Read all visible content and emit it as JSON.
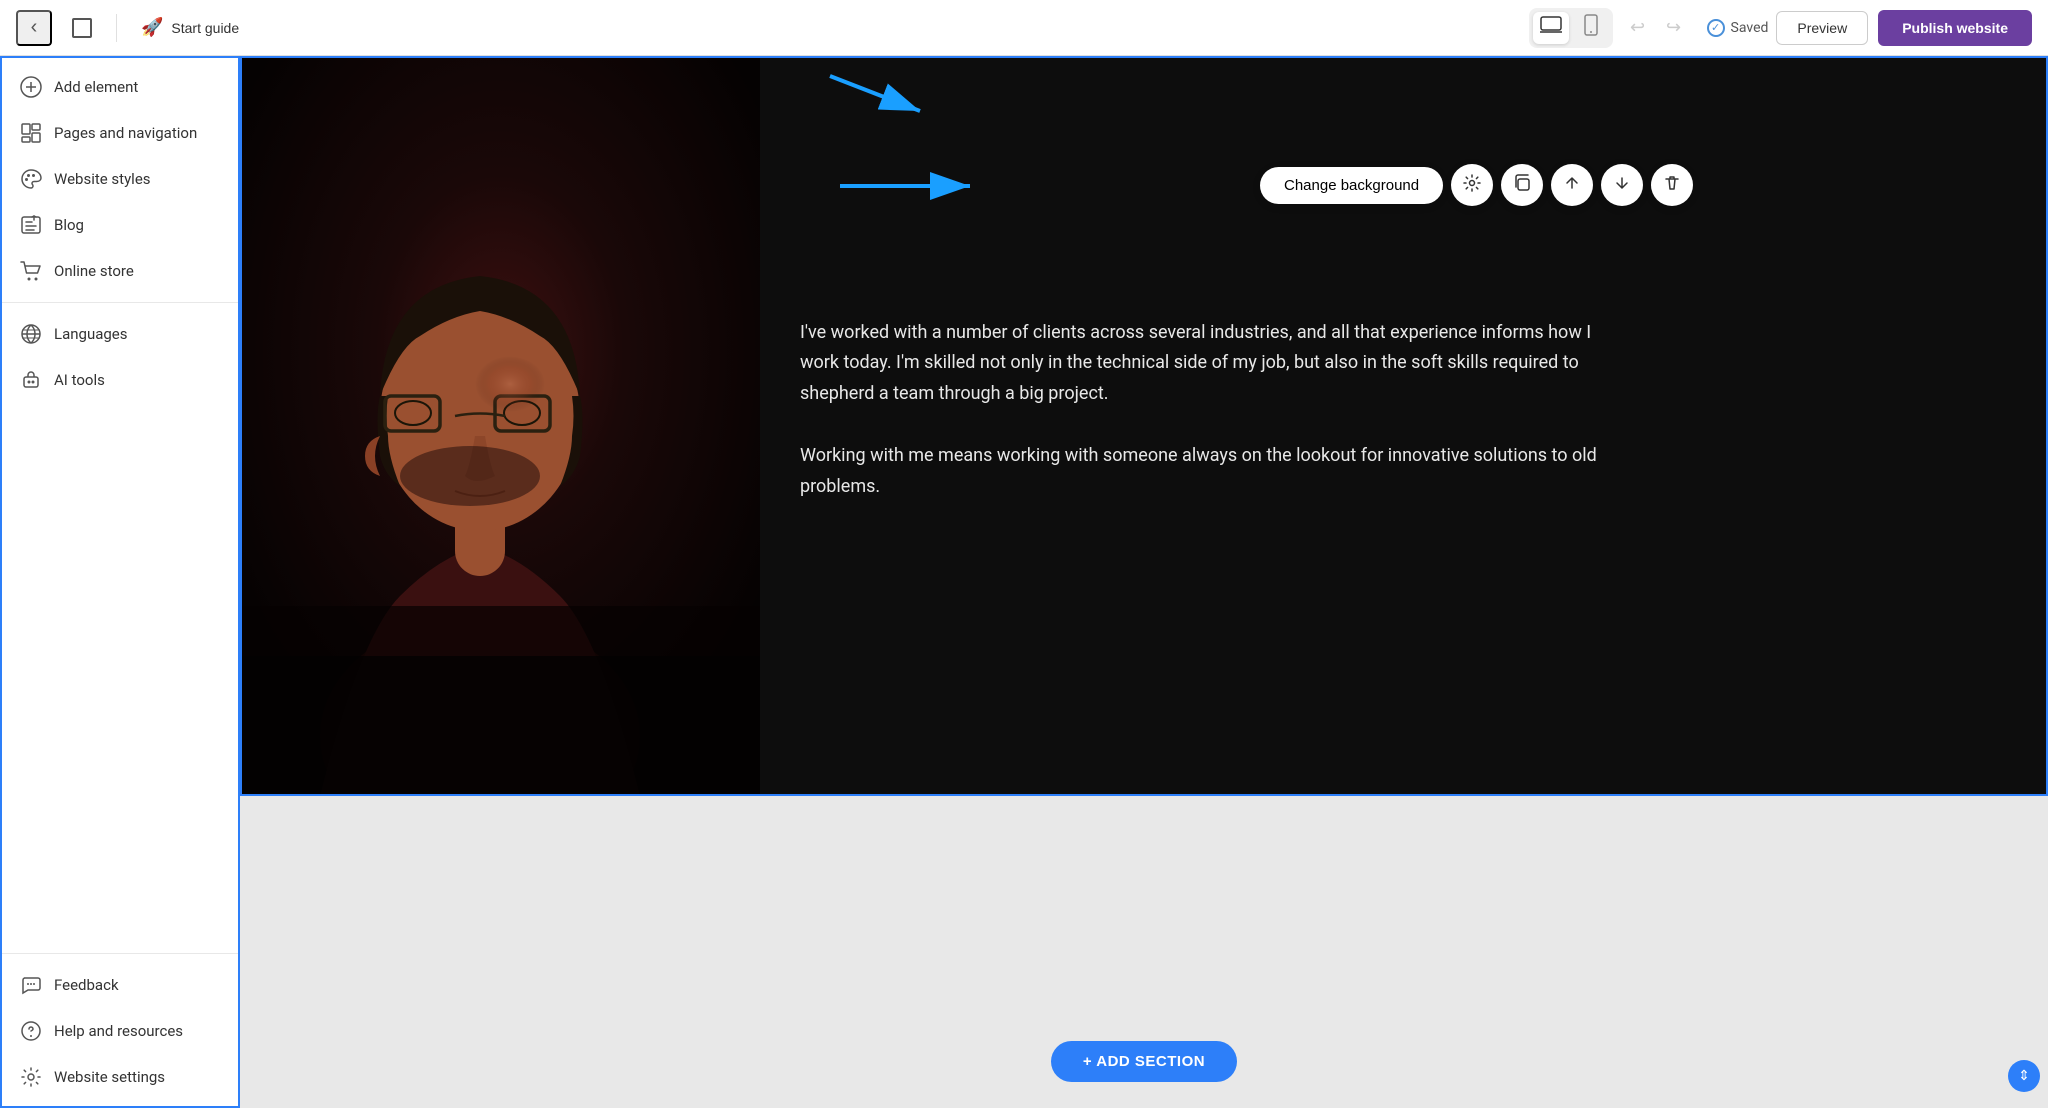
{
  "toolbar": {
    "back_icon": "‹",
    "layout_icon": "⊡",
    "start_guide_label": "Start guide",
    "device_laptop_icon": "💻",
    "device_mobile_icon": "📱",
    "undo_icon": "↩",
    "redo_icon": "↪",
    "saved_label": "Saved",
    "preview_label": "Preview",
    "publish_label": "Publish website"
  },
  "sidebar": {
    "items": [
      {
        "id": "add-element",
        "icon": "⊕",
        "label": "Add element"
      },
      {
        "id": "pages-navigation",
        "icon": "◫",
        "label": "Pages and navigation"
      },
      {
        "id": "website-styles",
        "icon": "🎨",
        "label": "Website styles"
      },
      {
        "id": "blog",
        "icon": "✏️",
        "label": "Blog"
      },
      {
        "id": "online-store",
        "icon": "🛒",
        "label": "Online store"
      },
      {
        "id": "languages",
        "icon": "✳",
        "label": "Languages"
      },
      {
        "id": "ai-tools",
        "icon": "🤖",
        "label": "AI tools"
      }
    ],
    "bottom_items": [
      {
        "id": "feedback",
        "icon": "📣",
        "label": "Feedback"
      },
      {
        "id": "help",
        "icon": "❓",
        "label": "Help and resources"
      },
      {
        "id": "website-settings",
        "icon": "⚙",
        "label": "Website settings"
      }
    ]
  },
  "floating_toolbar": {
    "change_bg_label": "Change background",
    "settings_icon": "⚙",
    "copy_icon": "⧉",
    "move_up_icon": "↑",
    "move_down_icon": "↓",
    "delete_icon": "🗑"
  },
  "canvas": {
    "paragraph1": "I've worked with a number of clients across several industries, and all that experience informs how I work today. I'm skilled not only in the technical side of my job, but also in the soft skills required to shepherd a team through a big project.",
    "paragraph2": "Working with me means working with someone always on the lookout for innovative solutions to old problems."
  },
  "add_section": {
    "label": "+ ADD SECTION"
  },
  "colors": {
    "accent_blue": "#2d7ff9",
    "publish_purple": "#6b3fa0",
    "canvas_bg": "#0d0d0d"
  }
}
